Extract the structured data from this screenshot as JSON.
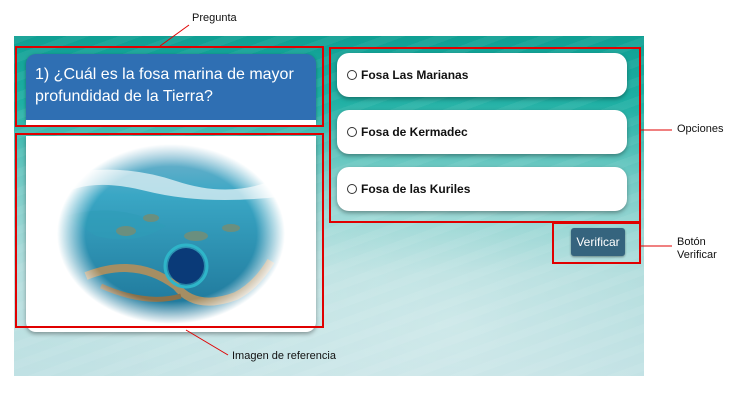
{
  "question": {
    "text": "1) ¿Cuál es la fosa marina de mayor profundidad de la Tierra?"
  },
  "options": [
    {
      "label": "Fosa Las Marianas"
    },
    {
      "label": "Fosa de Kermadec"
    },
    {
      "label": "Fosa de las Kuriles"
    }
  ],
  "verify_button": {
    "label": "Verificar"
  },
  "annotations": {
    "pregunta": "Pregunta",
    "opciones": "Opciones",
    "boton_line1": "Botón",
    "boton_line2": "Verificar",
    "imagen": "Imagen de referencia"
  },
  "colors": {
    "question_bg": "#2f6fb3",
    "verify_bg": "#35647e",
    "annotation_red": "#e00000"
  },
  "reference_image": {
    "icon": "reef-blue-hole-image"
  }
}
